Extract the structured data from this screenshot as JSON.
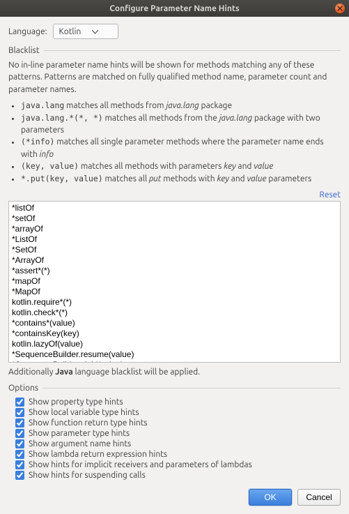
{
  "window": {
    "title": "Configure Parameter Name Hints"
  },
  "language": {
    "label": "Language:",
    "value": "Kotlin"
  },
  "blacklist": {
    "title": "Blacklist",
    "intro": "No in-line parameter name hints will be shown for methods matching any of these patterns. Patterns are matched on fully qualified method name, parameter count and parameter names.",
    "examples": [
      {
        "code": "java.lang",
        "pre": "",
        "post": " matches all methods from ",
        "ital1": "java.lang",
        "tail": " package"
      },
      {
        "code": "java.lang.*(*, *)",
        "pre": "",
        "post": " matches all methods from the ",
        "ital1": "java.lang",
        "tail": " package with two parameters"
      },
      {
        "code": "(*info)",
        "pre": "",
        "post": " matches all single parameter methods where the parameter name ends with ",
        "ital1": "info",
        "tail": ""
      },
      {
        "code": "(key, value)",
        "pre": "",
        "post": " matches all methods with parameters ",
        "ital1": "key",
        "mid": " and ",
        "ital2": "value",
        "tail": ""
      },
      {
        "code": "*.put(key, value)",
        "pre": "",
        "post": " matches all ",
        "ital1": "put",
        "mid": " methods with ",
        "ital2": "key",
        "mid2": " and ",
        "ital3": "value",
        "tail": " parameters"
      }
    ],
    "reset": "Reset",
    "entries": "*listOf\n*setOf\n*arrayOf\n*ListOf\n*SetOf\n*ArrayOf\n*assert*(*)\n*mapOf\n*MapOf\nkotlin.require*(*)\nkotlin.check*(*)\n*contains*(value)\n*containsKey(key)\nkotlin.lazyOf(value)\n*SequenceBuilder.resume(value)\n*SequenceBuilder.yield(value)",
    "additional_pre": "Additionally ",
    "additional_bold": "Java",
    "additional_post": " language blacklist will be applied."
  },
  "options": {
    "title": "Options",
    "items": [
      {
        "label": "Show property type hints",
        "checked": true
      },
      {
        "label": "Show local variable type hints",
        "checked": true
      },
      {
        "label": "Show function return type hints",
        "checked": true
      },
      {
        "label": "Show parameter type hints",
        "checked": true
      },
      {
        "label": "Show argument name hints",
        "checked": true
      },
      {
        "label": "Show lambda return expression hints",
        "checked": true
      },
      {
        "label": "Show hints for implicit receivers and parameters of lambdas",
        "checked": true
      },
      {
        "label": "Show hints for suspending calls",
        "checked": true
      }
    ]
  },
  "buttons": {
    "ok": "OK",
    "cancel": "Cancel"
  }
}
